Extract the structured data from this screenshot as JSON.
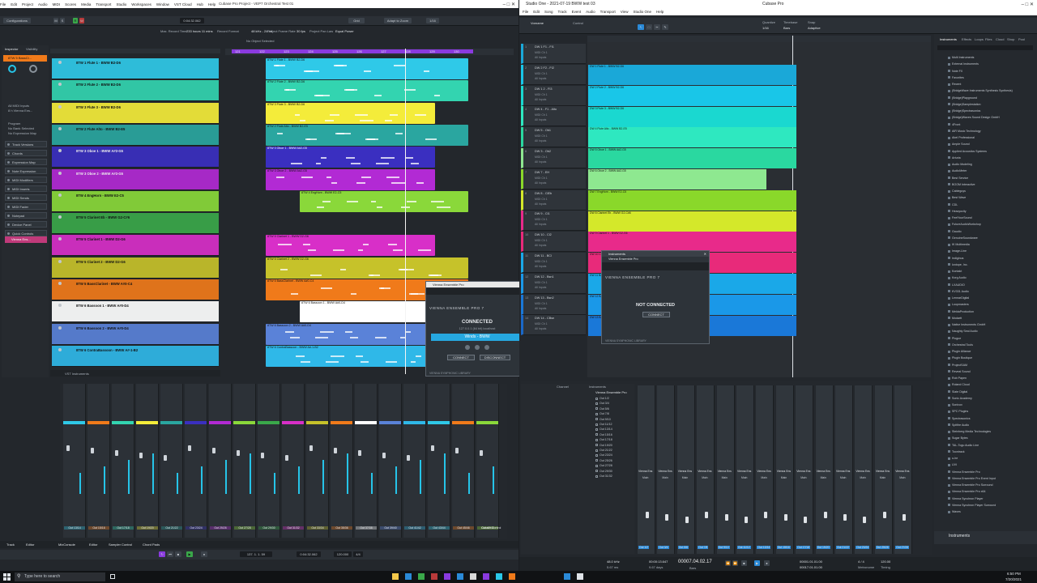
{
  "cubase": {
    "title": "Cubase Pro Project - VEP7 Orchestral Test 01",
    "menu": [
      "File",
      "Edit",
      "Project",
      "Audio",
      "MIDI",
      "Scores",
      "Media",
      "Transport",
      "Studio",
      "Workspaces",
      "Window",
      "VST Cloud",
      "Hub",
      "Help"
    ],
    "toolbar": {
      "configurations": "Configurations",
      "position": "0:04:32.062",
      "grid": "Grid",
      "adapt_to_zoom": "Adapt to Zoom",
      "quantize": "1/16",
      "max_record_time": "Max. Record Time",
      "record_time": "233 hours 11 mins",
      "record_format": "Record Format",
      "record_format_val": "48 kHz - 24 bit",
      "frame_rate": "Project Frame Rate",
      "frame_rate_val": "30 fps",
      "project_pan_law": "Project Pan Law",
      "pan_law_val": "Equal Power",
      "no_object": "No Object Selected"
    },
    "inspector_tabs": [
      "Inspector",
      "Visibility"
    ],
    "inspector_sections": [
      "Track Versions",
      "Chords",
      "Expression Map",
      "Note Expression",
      "MIDI Modifiers",
      "MIDI Inserts",
      "MIDI Sends",
      "MIDI Fader",
      "Notepad",
      "Device Panel",
      "Quick Controls"
    ],
    "inspector_track": "8TW 5 BassCl...",
    "inspector_vst": "Vienna Ens...",
    "inspector_input": "All MIDI Inputs",
    "inspector_output": "8 h Vienna Ens...",
    "inspector_program": "Program",
    "inspector_bank": "No Bank Selected",
    "inspector_expression": "No Expression Map",
    "ruler_marks": [
      "121",
      "122",
      "123",
      "124",
      "125",
      "126",
      "127",
      "128",
      "129",
      "130"
    ],
    "tracks": [
      {
        "name": "8TW 1 Flute 1 - BWW B2-D6",
        "color": "#2fc9e8",
        "clip": "8TW 1 Flute 1 - BWW B2-D6"
      },
      {
        "name": "8TW 2 Flute 2 - BWW B2-D6",
        "color": "#33d4b0",
        "clip": "8TW 2 Flute 2 - BWW B2-D6"
      },
      {
        "name": "8TW 3 Flute 3 - BWW B2-D6",
        "color": "#f4ec3a",
        "clip": "8TW 3 Flute 3 - BWW B2-D6"
      },
      {
        "name": "8TW 2 Flute Alto - BWW B2-E5",
        "color": "#2aa6a0",
        "clip": "8TW 2 Flute Alto - BWW B2-E5"
      },
      {
        "name": "8TW 3 Oboe 1 - BWW A#2-G5",
        "color": "#3a2fc0",
        "clip": "8TW 3 Oboe 1 - BWW A#2-G5"
      },
      {
        "name": "8TW 3 Oboe 2 - BWW A#2-G5",
        "color": "#b22ad4",
        "clip": "8TW 3 Oboe 2 - BWW A#2-G5"
      },
      {
        "name": "8TW 4 EngHorn - BWW E2-C5",
        "color": "#8ad83a",
        "clip": "8TW 4 EngHorn - BWW E2-C5"
      },
      {
        "name": "8TW 5 Clarinet Eb - BWW G2-C#6",
        "color": "#3aa84a",
        "clip": ""
      },
      {
        "name": "8TW 5 Clarinet 1 - BWW D2-G6",
        "color": "#d82fc8",
        "clip": "8TW 5 Clarinet 1 - BWW D2-G6"
      },
      {
        "name": "8TW 5 Clarinet 2 - BWW D2-G6",
        "color": "#c6c22a",
        "clip": "8TW 5 Clarinet 2 - BWW D2-G6"
      },
      {
        "name": "8TW 5 BassClarinet - BWW A#0-C4",
        "color": "#f07a1a",
        "clip": "8TW 5 BassClarinet - BWW A#0-C4"
      },
      {
        "name": "8TW 6 Bassoon 1 - BWW A#0-D4",
        "color": "#ffffff",
        "clip": "8TW 6 Bassoon 1 - BWW A#0-D4"
      },
      {
        "name": "8TW 6 Bassoon 2 - BWW A#0-D4",
        "color": "#5a82d8",
        "clip": "8TW 6 Bassoon 2 - BWW A#0-D4"
      },
      {
        "name": "8TW 6 ContraBassoon - BWW A#-1-B2",
        "color": "#2fb8e8",
        "clip": "8TW 6 ContraBassoon - BWW A#-1-B2"
      }
    ],
    "instruments_label": "VST Instruments",
    "mixer_channels": [
      "Out 13/14",
      "Out 15/16",
      "Out 17/18",
      "Out 19/20",
      "Out 21/22",
      "Out 23/24",
      "Out 25/26",
      "Out 27/28",
      "Out 29/30",
      "Out 31/32",
      "Out 33/34",
      "Out 35/36",
      "Out 37/38",
      "Out 39/40",
      "Out 41/42",
      "Out 43/44",
      "Out 45/46",
      "Out 47/48"
    ],
    "mixer_last": "Cubase Control",
    "bottom_tabs": [
      "Track",
      "Editor",
      "MixConsole",
      "Editor",
      "Sampler Control",
      "Chord Pads"
    ],
    "transport_pos": "137. 1. 1. 59",
    "transport_time": "0:04:32.062",
    "transport_tempo": "120.000",
    "transport_sig": "4/4"
  },
  "vep_cubase": {
    "title": "Vienna Ensemble Pro",
    "header": "VIENNA ENSEMBLE PRO 7",
    "status": "CONNECTED",
    "address": "127.0.0.1 (64 bit) localhost",
    "instance": "Winds - BWW",
    "connect": "CONNECT",
    "disconnect": "DISCONNECT",
    "footer": "VIENNA SYMPHONIC LIBRARY"
  },
  "studioone": {
    "title": "Studio One - 2021-07-19 BWW test 03",
    "app_title": "Cubase Pro",
    "menu": [
      "File",
      "Edit",
      "Song",
      "Track",
      "Event",
      "Audio",
      "Transport",
      "View",
      "Studio One",
      "Help"
    ],
    "toolbar": {
      "quantize": "Quantize",
      "timebase": "Timebase",
      "snap": "Snap",
      "quantize_val": "1/16",
      "timebase_val": "Bars",
      "snap_val": "Adaptive",
      "track_name": "Vorname",
      "control": "Control"
    },
    "lanes": [
      {
        "n": "1",
        "name": "DW 1 F1 - FI1"
      },
      {
        "n": "2",
        "name": "DW 2 F2 - FI2"
      },
      {
        "n": "3",
        "name": "DW 1 2 - FI3"
      },
      {
        "n": "4",
        "name": "DW 4 - F1 - Alto"
      },
      {
        "n": "5",
        "name": "DW 5 - Ob1"
      },
      {
        "n": "6",
        "name": "DW 3 - Ob2"
      },
      {
        "n": "7",
        "name": "DW 7 - EH"
      },
      {
        "n": "8",
        "name": "DW 8 - ClEb"
      },
      {
        "n": "9",
        "name": "DW 9 - Cl1"
      },
      {
        "n": "10",
        "name": "DW 10 - Cl2"
      },
      {
        "n": "11",
        "name": "DW 11 - BCl"
      },
      {
        "n": "12",
        "name": "DW 12 - Bsn1"
      },
      {
        "n": "13",
        "name": "DW 13 - Bsn2"
      },
      {
        "n": "14",
        "name": "DW 14 - CBsn"
      }
    ],
    "lane_sub": "MIDI Ch 1",
    "lane_sub2": "All Inputs",
    "clips": [
      {
        "label": "DW 1 Flute 1 - BWW B2-D6",
        "color": "#1aa8d8"
      },
      {
        "label": "DW 2 Flute 2 - BWW B2-D6",
        "color": "#19c6e8"
      },
      {
        "label": "DW 3 Flute 3 - BWW B2-D6",
        "color": "#1ad8d0"
      },
      {
        "label": "DW 4 Flute Alto - BWW B2-E5",
        "color": "#2ee8c0"
      },
      {
        "label": "DW 5 Oboe 1 - BWW A#2-G5",
        "color": "#2ad8a0"
      },
      {
        "label": "DW 6 Oboe 2 - BWW A#2-G5",
        "color": "#8ee890"
      },
      {
        "label": "DW 7 EngHorn - BWW E2-C5",
        "color": "#8ad82a"
      },
      {
        "label": "DW 8 Clarinet Eb - BWW G2-C#6",
        "color": "#d4e82a"
      },
      {
        "label": "DW 9 Clarinet 1 - BWW D2-G6",
        "color": "#e82a8a"
      },
      {
        "label": "DW 10 Clarinet 2 - BWW D2-G6",
        "color": "#e82a7a"
      },
      {
        "label": "DW 11 BassClarinet - BWW A#0-C4",
        "color": "#1aa8e8"
      },
      {
        "label": "DW 12 Bassoon 1 - BWW A#0-D4",
        "color": "#1a98e8"
      },
      {
        "label": "DW 13 Bassoon 2 - BWW A#0-D4",
        "color": "#1a78d8"
      }
    ],
    "browser_tabs": [
      "Instruments",
      "Effects",
      "Loops",
      "Files",
      "Cloud",
      "Shop",
      "Pool"
    ],
    "browser_items": [
      "Multi Instruments",
      "External Instruments",
      "Note FX",
      "Favorites",
      "Recent",
      "(BridgeWave Instruments Synthesis Synthesis)",
      "(Bridge)Playground",
      "(Bridge)Samplestation",
      "(Bridge)Spectrasonics",
      "(Bridge)Waves Sound Design GmbH",
      "4Front",
      "AIR Music Technology",
      "Abel Professional",
      "Ample Sound",
      "Applied Acoustics Systems",
      "Arturia",
      "Audio Modeling",
      "AudioMeter",
      "Best Service",
      "BOOM Interactive",
      "Cableguys",
      "Best Wave",
      "CDL",
      "Heavyocity",
      "FeelYourSound",
      "FutureAudioWorkshop",
      "Gaudio",
      "GenuineSoundware",
      "IK Multimedia",
      "Image-Line",
      "Indiginus",
      "Izotope, Inc.",
      "Kontakt",
      "Korg Audio",
      "LXAUDIO",
      "KV331 Audio",
      "LennarDigital",
      "Loopmasters",
      "MeldaProduction",
      "Modartt",
      "Native Instruments GmbH",
      "Naughty Seal Audio",
      "Plogue",
      "Orchestral Tools",
      "Plugin Alliance",
      "Plugin Boutique",
      "ProjectSAM",
      "Reveal Sound",
      "Rob Papen",
      "Roland Cloud",
      "Slate Digital",
      "Sonic Academy",
      "Sonivox",
      "SPC Plugins",
      "Spectrasonics",
      "Spitfire Audio",
      "Steinberg Media Technologies",
      "Sugar Bytes",
      "TAL-Togu Audio Line",
      "Toontrack",
      "u-he",
      "UVI",
      "Vienna Ensemble Pro",
      "Vienna Ensemble Pro Event Input",
      "Vienna Ensemble Pro Surround",
      "Vienna Ensemble Pro x64",
      "Vienna Synchron Player",
      "Vienna Synchron Player Surround",
      "Waves"
    ],
    "instruments_footer": "Instruments",
    "routing_header": [
      "Channel",
      "Instruments"
    ],
    "routing_root": "Vienna Ensemble Pro",
    "routing": [
      "Out 1/2",
      "Out 3/4",
      "Out 5/6",
      "Out 7/8",
      "Out 9/10",
      "Out 11/12",
      "Out 13/14",
      "Out 15/16",
      "Out 17/18",
      "Out 19/20",
      "Out 21/22",
      "Out 23/24",
      "Out 25/26",
      "Out 27/28",
      "Out 29/30",
      "Out 31/32"
    ],
    "mixer_names": [
      "Vienna Ens",
      "Vienna Ens",
      "Vienna Ens",
      "Vienna Ens",
      "Vienna Ens",
      "Vienna Ens",
      "Vienna Ens",
      "Vienna Ens",
      "Vienna Ens",
      "Vienna Ens",
      "Vienna Ens",
      "Vienna Ens",
      "Vienna Ens",
      "Vienna Ens"
    ],
    "mixer_outs": [
      "Out 1/2",
      "Out 3/4",
      "Out 5/6",
      "Out 7/8",
      "Out 9/10",
      "Out 11/12",
      "Out 13/14",
      "Out 15/16",
      "Out 17/18",
      "Out 19/20",
      "Out 21/22",
      "Out 23/24",
      "Out 25/26",
      "Out 27/28"
    ],
    "main_out": "Main",
    "transport": {
      "sample_rate": "48.0 kHz",
      "latency": "5.67 ms",
      "time": "00:00:13.647",
      "days": "9.67 days",
      "position": "00007.04.02.17",
      "bars": "Bars",
      "left": "00001.01.01.00",
      "right": "00017.01.01.00",
      "sig": "4 / 4",
      "tempo": "120.00",
      "metronome": "Metronome",
      "timing": "Timing"
    }
  },
  "vep_s1": {
    "title": "Instruments",
    "inner_title": "Vienna Ensemble Pro",
    "header": "VIENNA ENSEMBLE PRO 7",
    "status": "NOT CONNECTED",
    "connect": "CONNECT",
    "footer": "VIENNA SYMPHONIC LIBRARY"
  },
  "taskbar": {
    "search": "Type here to search",
    "time": "6:50 PM",
    "date": "7/20/2021"
  }
}
